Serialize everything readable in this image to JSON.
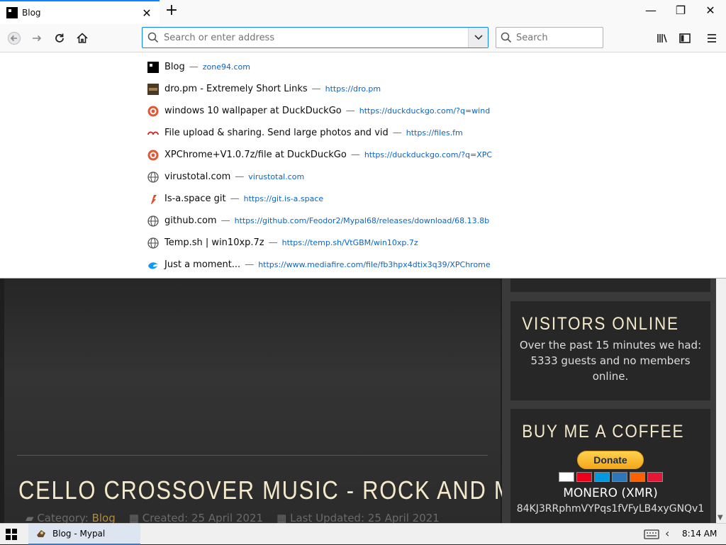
{
  "browser": {
    "tab": {
      "title": "Blog",
      "close_label": "✕"
    },
    "new_tab_label": "+",
    "window_controls": {
      "minimize": "—",
      "restore": "❐",
      "close": "✕"
    },
    "url_placeholder": "Search or enter address",
    "search_placeholder": "Search"
  },
  "autocomplete": [
    {
      "title": "Blog",
      "url": "zone94.com",
      "icon": "black-square-icon"
    },
    {
      "title": "dro.pm - Extremely Short Links",
      "url": "https://dro.pm",
      "icon": "dro-pm-icon"
    },
    {
      "title": "windows 10 wallpaper at DuckDuckGo",
      "url": "https://duckduckgo.com/?q=wind",
      "icon": "duckduckgo-icon"
    },
    {
      "title": "File upload & sharing. Send large photos and vid",
      "url": "https://files.fm",
      "icon": "files-fm-icon"
    },
    {
      "title": "XPChrome+V1.0.7z/file at DuckDuckGo",
      "url": "https://duckduckgo.com/?q=XPC",
      "icon": "duckduckgo-icon"
    },
    {
      "title": "virustotal.com",
      "url": "virustotal.com",
      "icon": "globe-icon"
    },
    {
      "title": "Is-a.space git",
      "url": "https://git.is-a.space",
      "icon": "git-icon"
    },
    {
      "title": "github.com",
      "url": "https://github.com/Feodor2/Mypal68/releases/download/68.13.8b",
      "icon": "globe-icon"
    },
    {
      "title": "Temp.sh | win10xp.7z",
      "url": "https://temp.sh/VtGBM/win10xp.7z",
      "icon": "globe-icon"
    },
    {
      "title": "Just a moment...",
      "url": "https://www.mediafire.com/file/fb3hpx4dtix3q39/XPChrome",
      "icon": "mediafire-icon"
    }
  ],
  "separator": "—",
  "page": {
    "article_title": "CELLO CROSSOVER MUSIC - ROCK AND METAL",
    "meta": {
      "category_label": "Category:",
      "category_value": "Blog",
      "created": "Created: 25 April 2021",
      "updated": "Last Updated: 25 April 2021"
    },
    "visitors": {
      "title": "VISITORS ONLINE",
      "text": "Over the past 15 minutes we had: 5333 guests and no members online."
    },
    "coffee": {
      "title": "BUY ME A COFFEE",
      "donate_label": "Donate",
      "coin_name": "MONERO (XMR)",
      "coin_address": "84KJ3RRphmVYPqs1fVFyLB4xyGNQv1"
    }
  },
  "taskbar": {
    "app_label": "Blog - Mypal",
    "clock": "8:14 AM"
  }
}
